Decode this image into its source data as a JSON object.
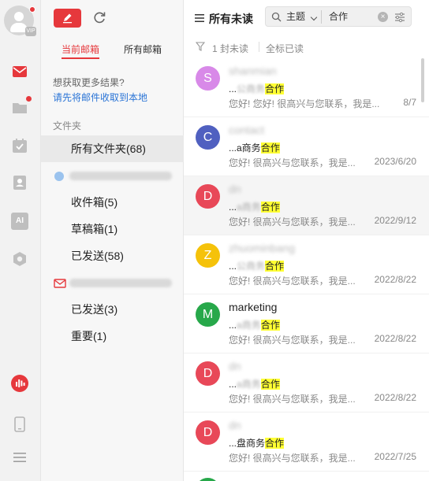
{
  "rail": {
    "icons": [
      "mail-icon",
      "folder-icon",
      "calendar-icon",
      "contacts-icon",
      "ai-icon",
      "settings-icon",
      "assistant-icon",
      "phone-icon",
      "menu-icon"
    ],
    "avatar_badge": "VIP",
    "ai_label": "AI",
    "accent": "#e6383c"
  },
  "folders": {
    "tabs": [
      "当前邮箱",
      "所有邮箱"
    ],
    "hint": "想获取更多结果?",
    "hint_link": "请先将邮件收取到本地",
    "section_label": "文件夹",
    "items": [
      {
        "label": "所有文件夹(68)"
      },
      {
        "label": "收件箱(5)"
      },
      {
        "label": "草稿箱(1)"
      },
      {
        "label": "已发送(58)"
      },
      {
        "label": "已发送(3)"
      },
      {
        "label": "重要(1)"
      }
    ]
  },
  "list": {
    "title": "所有未读",
    "search": {
      "scope": "主题",
      "keyword": "合作",
      "clear": "×"
    },
    "unread_count": "1 封未读",
    "mark_all": "全标已读",
    "rows": [
      {
        "initial": "S",
        "color": "#d889e8",
        "sender": "shanmian",
        "sender_blurred": true,
        "subject_pre": "...",
        "subject_blur": "公商务",
        "subject_hl": "合作",
        "snippet": "您好! 您好!  很高兴与您联系，我是...",
        "date": "8/7"
      },
      {
        "initial": "C",
        "color": "#5060c0",
        "sender": "contact",
        "sender_blurred": true,
        "subject_pre": "...a商务",
        "subject_blur": "",
        "subject_hl": "合作",
        "snippet": "您好!  很高兴与您联系，我是...",
        "date": "2023/6/20"
      },
      {
        "initial": "D",
        "color": "#e84858",
        "sender": "dn",
        "sender_blurred": true,
        "subject_pre": "...",
        "subject_blur": "a商务",
        "subject_hl": "合作",
        "snippet": "您好!  很高兴与您联系，我是...",
        "date": "2022/9/12"
      },
      {
        "initial": "Z",
        "color": "#f5c20a",
        "sender": "zhuominbang",
        "sender_blurred": true,
        "subject_pre": "...",
        "subject_blur": "公商务",
        "subject_hl": "合作",
        "snippet": "您好!  很高兴与您联系，我是...",
        "date": "2022/8/22"
      },
      {
        "initial": "M",
        "color": "#27a84a",
        "sender": "marketing",
        "sender_blurred": false,
        "subject_pre": "...",
        "subject_blur": "a商务",
        "subject_hl": "合作",
        "snippet": "您好!  很高兴与您联系，我是...",
        "date": "2022/8/22"
      },
      {
        "initial": "D",
        "color": "#e84858",
        "sender": "dn",
        "sender_blurred": true,
        "subject_pre": "...",
        "subject_blur": "a商务",
        "subject_hl": "合作",
        "snippet": "您好!  很高兴与您联系，我是...",
        "date": "2022/8/22"
      },
      {
        "initial": "D",
        "color": "#e84858",
        "sender": "dn",
        "sender_blurred": true,
        "subject_pre": "...盘商务",
        "subject_blur": "",
        "subject_hl": "合作",
        "snippet": "您好!  很高兴与您联系，我是...",
        "date": "2022/7/25"
      }
    ]
  }
}
